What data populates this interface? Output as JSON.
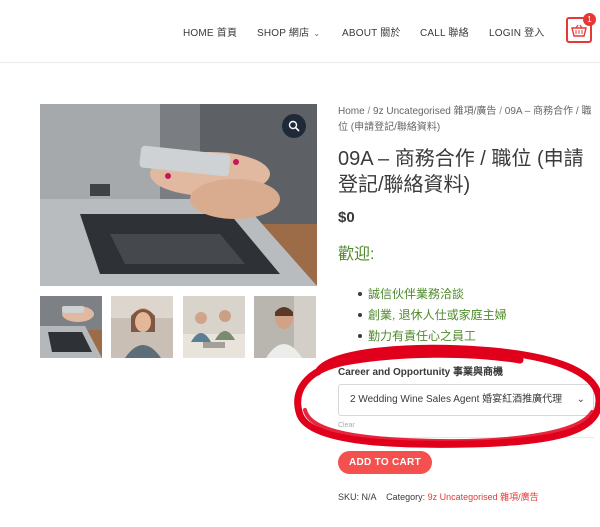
{
  "nav": {
    "home": "HOME 首頁",
    "shop": "SHOP 網店",
    "about": "ABOUT 關於",
    "call": "CALL 聯絡",
    "login": "LOGIN 登入",
    "cart_count": "1"
  },
  "gallery": {
    "main_image": "hands-holding-phone-over-laptop",
    "thumbnails": [
      "phone-laptop",
      "woman-smiling",
      "office-meeting",
      "man-smiling"
    ]
  },
  "breadcrumb": {
    "home": "Home",
    "category": "9z Uncategorised 雜項/廣告",
    "current": "09A – 商務合作 / 職位 (申請登記/聯絡資料)"
  },
  "product": {
    "title": "09A – 商務合作 / 職位 (申請登記/聯絡資料)",
    "price": "$0",
    "welcome": "歡迎:",
    "bullets": [
      "誠信伙伴業務洽談",
      "創業, 退休人仕或家庭主婦",
      "勤力有責任心之員工"
    ]
  },
  "options": {
    "label": "Career and Opportunity 事業與商機",
    "selected": "2 Wedding Wine Sales Agent 婚宴紅酒推廣代理",
    "clear": "Clear"
  },
  "actions": {
    "add_to_cart": "ADD TO CART"
  },
  "meta": {
    "sku_label": "SKU:",
    "sku_value": "N/A",
    "category_label": "Category:",
    "category_value": "9z Uncategorised 雜項/廣告"
  },
  "colors": {
    "accent": "#f4504e",
    "green_text": "#4e8a2b",
    "annotation": "#e0001b"
  }
}
